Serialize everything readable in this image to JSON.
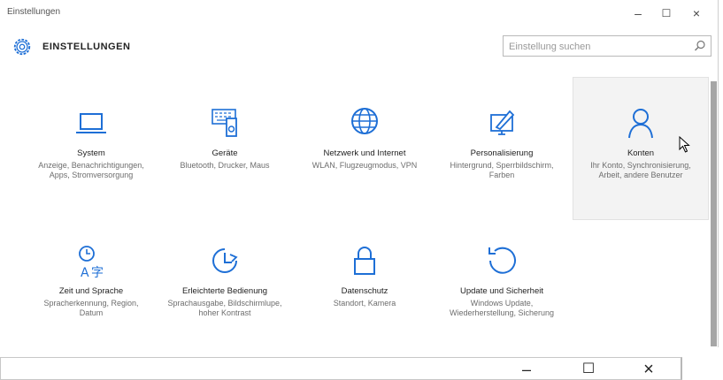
{
  "window": {
    "title": "Einstellungen",
    "controls": {
      "minimize": "–",
      "maximize": "☐",
      "close": "×"
    }
  },
  "header": {
    "heading": "EINSTELLUNGEN",
    "search_placeholder": "Einstellung suchen"
  },
  "tiles": [
    {
      "name": "System",
      "desc": "Anzeige, Benachrichtigungen, Apps, Stromversorgung",
      "icon": "laptop-icon"
    },
    {
      "name": "Geräte",
      "desc": "Bluetooth, Drucker, Maus",
      "icon": "devices-icon"
    },
    {
      "name": "Netzwerk und Internet",
      "desc": "WLAN, Flugzeugmodus, VPN",
      "icon": "globe-icon"
    },
    {
      "name": "Personalisierung",
      "desc": "Hintergrund, Sperrbildschirm, Farben",
      "icon": "paint-icon"
    },
    {
      "name": "Konten",
      "desc": "Ihr Konto, Synchronisierung, Arbeit, andere Benutzer",
      "icon": "person-icon"
    },
    {
      "name": "Zeit und Sprache",
      "desc": "Spracherkennung, Region, Datum",
      "icon": "time-language-icon"
    },
    {
      "name": "Erleichterte Bedienung",
      "desc": "Sprachausgabe, Bildschirmlupe, hoher Kontrast",
      "icon": "accessibility-icon"
    },
    {
      "name": "Datenschutz",
      "desc": "Standort, Kamera",
      "icon": "lock-icon"
    },
    {
      "name": "Update und Sicherheit",
      "desc": "Windows Update, Wiederherstellung, Sicherung",
      "icon": "update-icon"
    }
  ],
  "second_window": {
    "controls": {
      "minimize": "–",
      "maximize": "☐",
      "close": "×"
    }
  },
  "accent_color": "#1e6fd6"
}
